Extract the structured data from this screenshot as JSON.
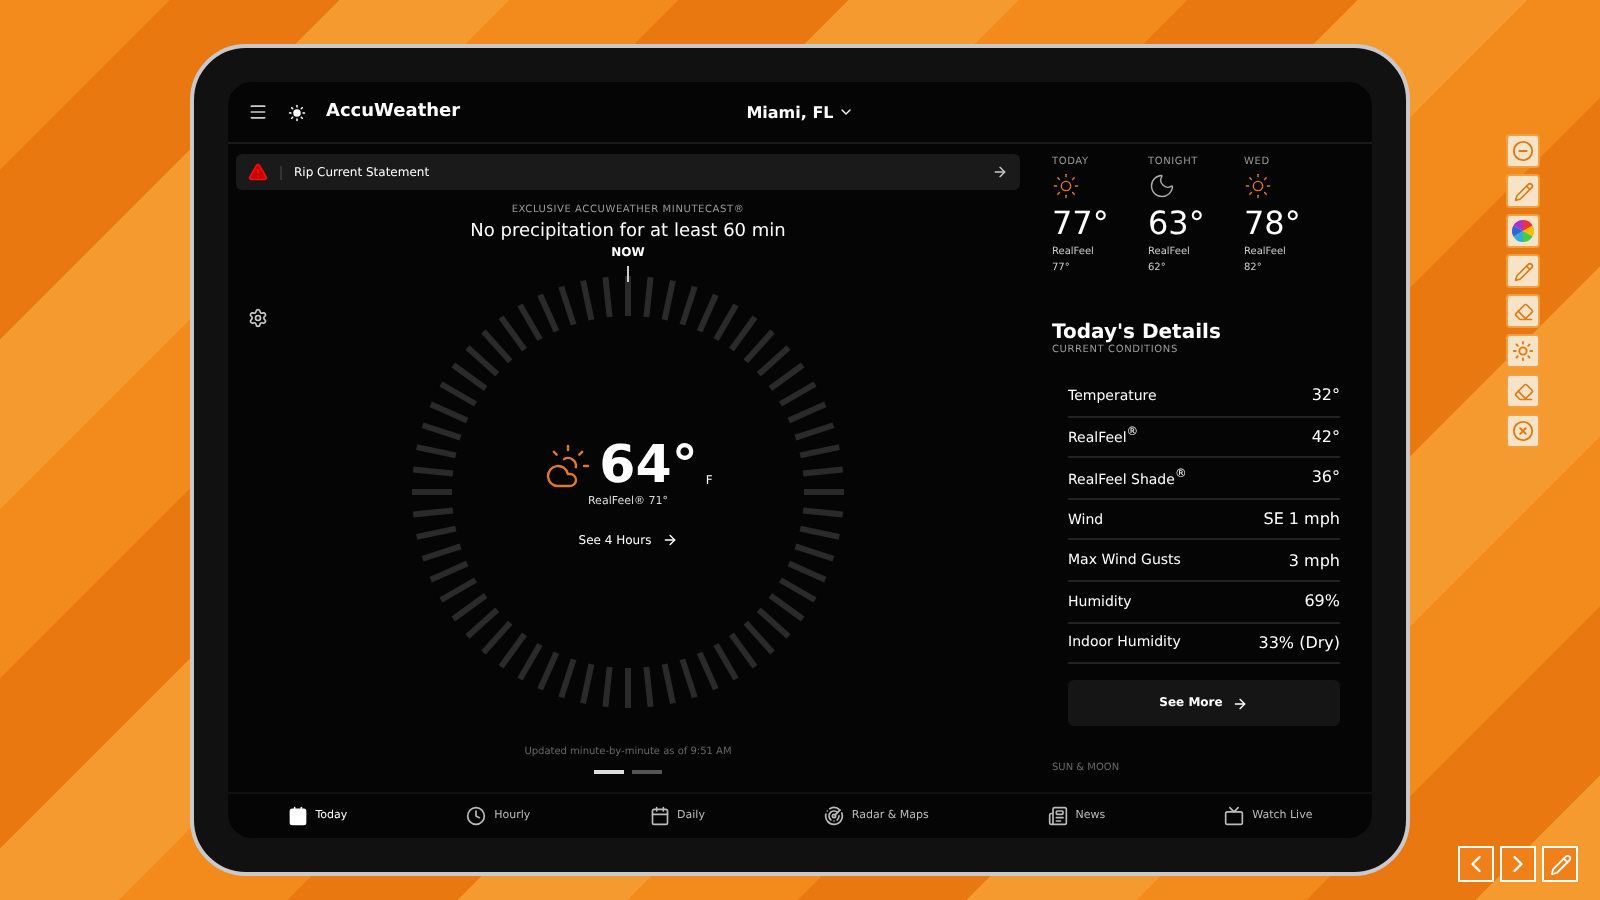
{
  "header": {
    "logo": "AccuWeather",
    "location": "Miami, FL"
  },
  "alert": {
    "title": "Rip Current Statement"
  },
  "minutecast": {
    "label": "EXCLUSIVE ACCUWEATHER MINUTECAST®",
    "summary": "No precipitation for at least 60 min",
    "dial_label": "NOW",
    "temperature": "64°",
    "unit": "F",
    "realfeel": "RealFeel® 71°",
    "link": "See 4 Hours",
    "updated": "Updated minute-by-minute as of 9:51 AM"
  },
  "pages": [
    {
      "selected": true
    },
    {
      "selected": false
    }
  ],
  "forecast": [
    {
      "label": "TODAY",
      "kind": "sun",
      "temperature": "77°",
      "realfeel_label": "RealFeel",
      "realfeel": "77°"
    },
    {
      "label": "TONIGHT",
      "kind": "moon",
      "temperature": "63°",
      "realfeel_label": "RealFeel",
      "realfeel": "62°"
    },
    {
      "label": "WED",
      "kind": "sun",
      "temperature": "78°",
      "realfeel_label": "RealFeel",
      "realfeel": "82°"
    }
  ],
  "details": {
    "title": "Today's Details",
    "subtitle": "CURRENT CONDITIONS",
    "rows": [
      {
        "label": "Temperature",
        "value": "32°"
      },
      {
        "label": "RealFeel$^{®}$",
        "value": "42°"
      },
      {
        "label": "RealFeel Shade$^{®}$",
        "value": "36°"
      },
      {
        "label": "Wind",
        "value": "SE 1 mph"
      },
      {
        "label": "Max Wind Gusts",
        "value": "3 mph"
      },
      {
        "label": "Humidity",
        "value": "69%"
      },
      {
        "label": "Indoor Humidity",
        "value": "33% (Dry)"
      }
    ],
    "button": "See More",
    "next_section": "SUN & MOON"
  },
  "tabs": [
    {
      "label": "Today",
      "kind": "calendar-filled",
      "selected": true
    },
    {
      "label": "Hourly",
      "kind": "clock",
      "selected": false
    },
    {
      "label": "Daily",
      "kind": "calendar",
      "selected": false
    },
    {
      "label": "Radar & Maps",
      "kind": "radar",
      "selected": false
    },
    {
      "label": "News",
      "kind": "news",
      "selected": false
    },
    {
      "label": "Watch Live",
      "kind": "tv",
      "selected": false
    }
  ],
  "tools": [
    {
      "kind": "minus"
    },
    {
      "kind": "pen"
    },
    {
      "kind": "color"
    },
    {
      "kind": "pen"
    },
    {
      "kind": "eraser"
    },
    {
      "kind": "sun"
    },
    {
      "kind": "eraser"
    },
    {
      "kind": "close"
    }
  ],
  "nav": [
    {
      "kind": "prev"
    },
    {
      "kind": "next"
    },
    {
      "kind": "pen"
    }
  ]
}
